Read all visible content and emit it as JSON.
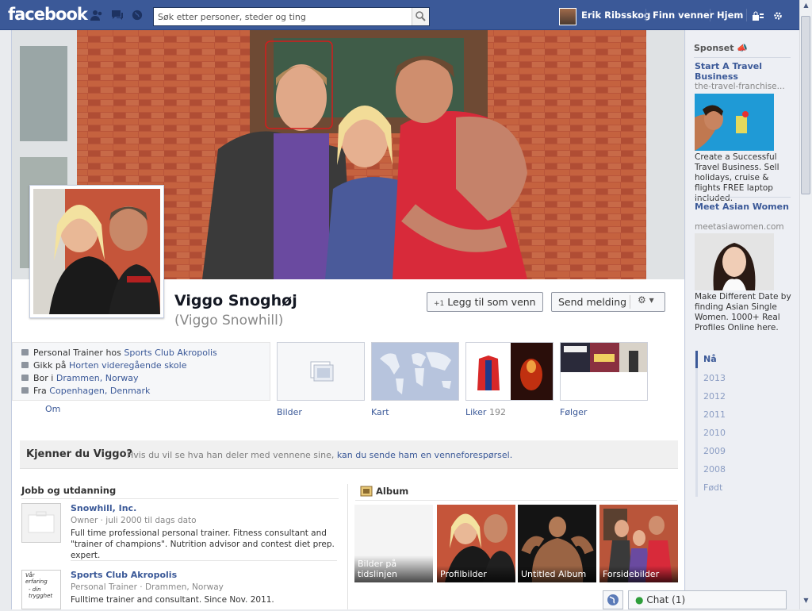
{
  "topbar": {
    "logo": "facebook",
    "search_placeholder": "Søk etter personer, steder og ting",
    "user_name": "Erik Ribsskog",
    "find_friends": "Finn venner",
    "home": "Hjem"
  },
  "profile": {
    "name": "Viggo Snoghøj",
    "alternate_name": "(Viggo Snowhill)",
    "add_friend_label": "Legg til som venn",
    "send_message_label": "Send melding"
  },
  "info": {
    "work_prefix": "Personal Trainer hos",
    "work_link": "Sports Club Akropolis",
    "school_prefix": "Gikk på",
    "school_link": "Horten videregående skole",
    "lives_prefix": "Bor i",
    "lives_link": "Drammen, Norway",
    "from_prefix": "Fra",
    "from_link": "Copenhagen, Denmark",
    "about_link": "Om"
  },
  "tiles": {
    "photos": "Bilder",
    "map": "Kart",
    "likes": "Liker",
    "likes_count": "192",
    "follows": "Følger"
  },
  "know": {
    "question": "Kjenner du Viggo?",
    "text": "Hvis du vil se hva han deler med vennene sine,",
    "link": "kan du sende ham en venneforespørsel."
  },
  "work_section": {
    "heading": "Jobb og utdanning",
    "jobs": [
      {
        "title": "Snowhill, Inc.",
        "sub": "Owner · juli 2000 til dags dato",
        "desc": "Full time professional personal trainer. Fitness consultant and \"trainer of champions\". Nutrition advisor and contest diet prep. expert."
      },
      {
        "title": "Sports Club Akropolis",
        "sub": "Personal Trainer · Drammen, Norway",
        "desc": "Fulltime trainer and consultant. Since Nov. 2011."
      }
    ],
    "job2_logo_text_1": "Vår erfaring",
    "job2_logo_text_2": "- din trygghet"
  },
  "albums": {
    "heading": "Album",
    "items": [
      {
        "label": "Bilder på tidslinjen"
      },
      {
        "label": "Profilbilder"
      },
      {
        "label": "Untitled Album"
      },
      {
        "label": "Forsidebilder"
      }
    ]
  },
  "ads": {
    "sponsored": "Sponset",
    "ad1": {
      "title": "Start A Travel Business",
      "url": "the-travel-franchise...",
      "body": "Create a Successful Travel Business. Sell holidays, cruise & flights FREE laptop included."
    },
    "ad2": {
      "title": "Meet Asian Women",
      "url": "meetasiawomen.com",
      "body": "Make Different Date by finding Asian Single Women. 1000+ Real Profiles Online here."
    }
  },
  "timeline_years": [
    "Nå",
    "2013",
    "2012",
    "2011",
    "2010",
    "2009",
    "2008",
    "Født"
  ],
  "chat": {
    "label": "Chat (1)"
  },
  "colors": {
    "brand": "#3b5998",
    "link": "#3b5998"
  }
}
